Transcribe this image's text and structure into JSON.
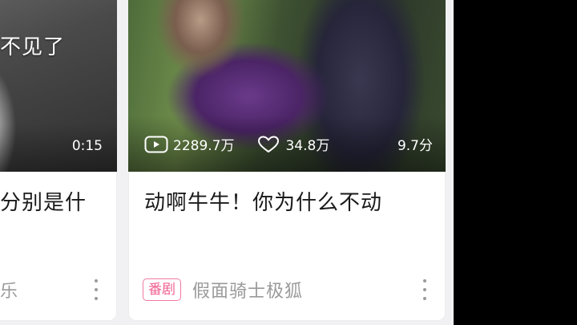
{
  "cards": [
    {
      "overlay_caption": "不见了",
      "duration": "0:15",
      "title": "分别是什",
      "uploader": "乐"
    },
    {
      "stats": {
        "plays": "2289.7万",
        "likes": "34.8万",
        "duration": "9.7分"
      },
      "title": "动啊牛牛！你为什么不动",
      "badge": "番剧",
      "uploader": "假面骑士极狐"
    }
  ],
  "colors": {
    "badge": "#f06292",
    "meta_text": "#9a9a9a",
    "title_text": "#1a1a1a"
  },
  "icons": [
    "play-count-icon",
    "like-icon",
    "more-icon"
  ]
}
